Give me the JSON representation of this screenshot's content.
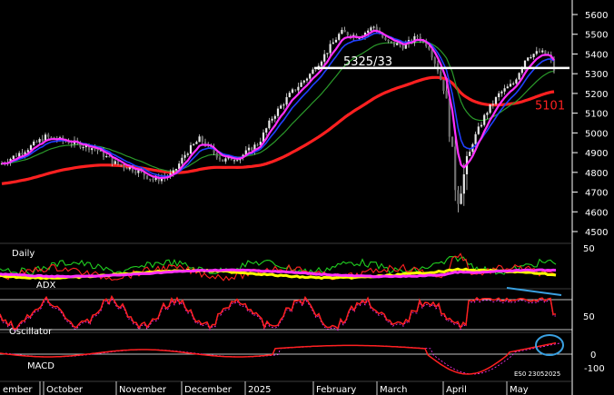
{
  "chart_data": [
    {
      "type": "candlestick",
      "instrument": "ES0 23052025",
      "y_axis": {
        "ylim": [
          4400,
          5700
        ],
        "ticks": [
          4500,
          4600,
          4700,
          4800,
          4900,
          5000,
          5100,
          5200,
          5300,
          5400,
          5500,
          5600
        ]
      },
      "x_axis": {
        "labels": [
          "ember",
          "October",
          "November",
          "December",
          "2025",
          "February",
          "March",
          "April",
          "May"
        ]
      },
      "annotations": [
        {
          "text": "5325/33",
          "value": 5329,
          "kind": "horizontal-line"
        },
        {
          "text": "5101",
          "value": 5101,
          "kind": "label",
          "color": "#ff2020"
        }
      ],
      "series": [
        {
          "kind": "candles",
          "color": "#ffffff"
        },
        {
          "kind": "moving-average",
          "color": "#ff2020"
        },
        {
          "kind": "moving-average",
          "color": "#2a9a2a"
        },
        {
          "kind": "moving-average",
          "color": "#2040ff"
        },
        {
          "kind": "moving-average",
          "color": "#ff30ff"
        }
      ],
      "legend": "none",
      "grid": false
    },
    {
      "type": "line",
      "panel": "indicator",
      "labels": [
        "Daily",
        "ADX"
      ],
      "y_ticks": [
        50
      ],
      "series_colors": [
        "#20d020",
        "#ff2020",
        "#ffff00",
        "#ff30ff"
      ]
    },
    {
      "type": "line",
      "panel": "indicator",
      "labels": [
        "Oscillator"
      ],
      "y_ticks": [
        50
      ],
      "series_colors": [
        "#ff2020",
        "#ff30ff"
      ]
    },
    {
      "type": "line",
      "panel": "indicator",
      "labels": [
        "MACD",
        "ES0 23052025"
      ],
      "y_ticks": [
        0,
        -100
      ],
      "series_colors": [
        "#ff2020",
        "#ff30ff"
      ],
      "highlight": "circle at the latest MACD crossover"
    }
  ]
}
